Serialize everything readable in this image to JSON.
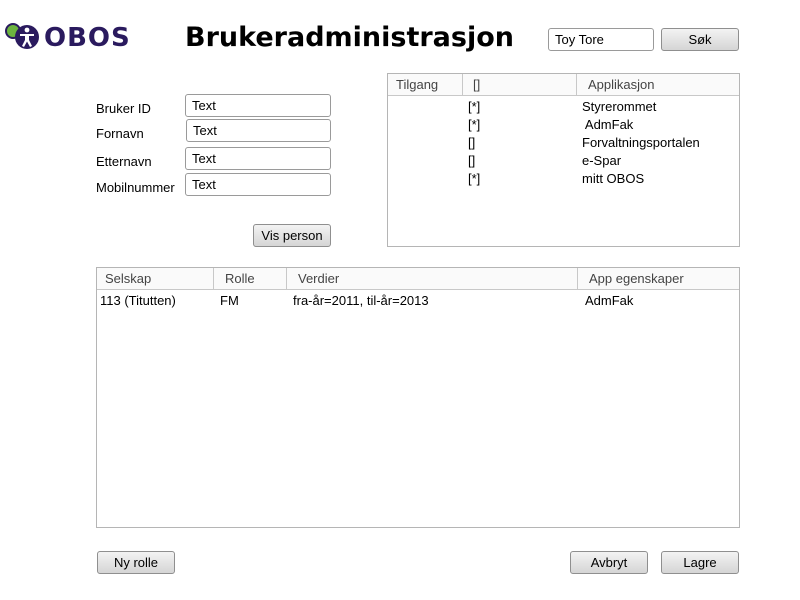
{
  "brand": {
    "name": "OBOS",
    "accent": "#2a1a5e",
    "icon_green": "#6cb33f"
  },
  "header": {
    "title": "Brukeradministrasjon"
  },
  "search": {
    "value": "Toy Tore",
    "button": "Søk"
  },
  "form": {
    "fields": [
      {
        "label": "Bruker ID",
        "value": "Text"
      },
      {
        "label": "Fornavn",
        "value": "Text"
      },
      {
        "label": "Etternavn",
        "value": "Text"
      },
      {
        "label": "Mobilnummer",
        "value": "Text"
      }
    ],
    "show_button": "Vis person"
  },
  "access_table": {
    "columns": [
      "Tilgang",
      "[]",
      "Applikasjon"
    ],
    "rows": [
      {
        "check": "[*]",
        "app": "Styrerommet"
      },
      {
        "check": "[*]",
        "app": " AdmFak"
      },
      {
        "check": "[]",
        "app": "Forvaltningsportalen"
      },
      {
        "check": "[]",
        "app": "e-Spar"
      },
      {
        "check": "[*]",
        "app": "mitt OBOS"
      }
    ]
  },
  "roles_table": {
    "columns": [
      "Selskap",
      "Rolle",
      "Verdier",
      "App egenskaper"
    ],
    "rows": [
      {
        "company": "113 (Titutten)",
        "role": "FM",
        "values": "fra-år=2011, til-år=2013",
        "app_props": "AdmFak"
      }
    ]
  },
  "footer": {
    "new_role": "Ny rolle",
    "cancel": "Avbryt",
    "save": "Lagre"
  }
}
